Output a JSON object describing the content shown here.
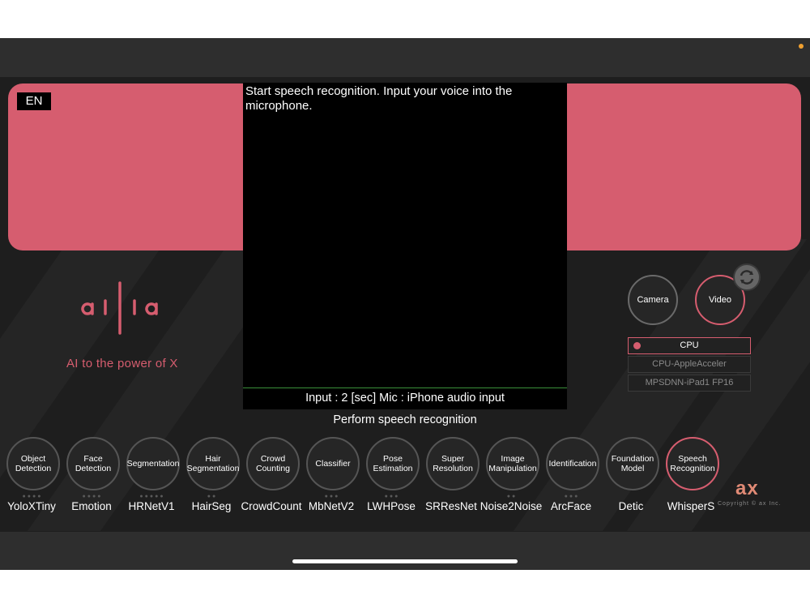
{
  "lang_badge": "EN",
  "video": {
    "message": "Start speech recognition. Input your voice into the microphone.",
    "input_info": "Input : 2 [sec] Mic : iPhone audio input"
  },
  "task_label": "Perform speech recognition",
  "branding": {
    "tagline": "AI to the power of X",
    "ax_logo": "ax",
    "copyright": "Copyright © ax Inc."
  },
  "modes": {
    "camera": "Camera",
    "video": "Video",
    "active": "video"
  },
  "compute": {
    "options": [
      "CPU",
      "CPU-AppleAcceler",
      "MPSDNN-iPad1 FP16"
    ],
    "selected": "CPU"
  },
  "models": [
    {
      "category": "Object Detection",
      "name": "YoloXTiny"
    },
    {
      "category": "Face Detection",
      "name": "Emotion"
    },
    {
      "category": "Segmentation",
      "name": "HRNetV1"
    },
    {
      "category": "Hair Segmentation",
      "name": "HairSeg"
    },
    {
      "category": "Crowd Counting",
      "name": "CrowdCount"
    },
    {
      "category": "Classifier",
      "name": "MbNetV2"
    },
    {
      "category": "Pose Estimation",
      "name": "LWHPose"
    },
    {
      "category": "Super Resolution",
      "name": "SRResNet"
    },
    {
      "category": "Image Manipulation",
      "name": "Noise2Noise"
    },
    {
      "category": "Identification",
      "name": "ArcFace"
    },
    {
      "category": "Foundation Model",
      "name": "Detic"
    },
    {
      "category": "Speech Recognition",
      "name": "WhisperS"
    }
  ],
  "active_model": "Speech Recognition",
  "colors": {
    "accent": "#d65d6f",
    "background": "#1e1e1e",
    "ax_logo": "#e08a75"
  }
}
